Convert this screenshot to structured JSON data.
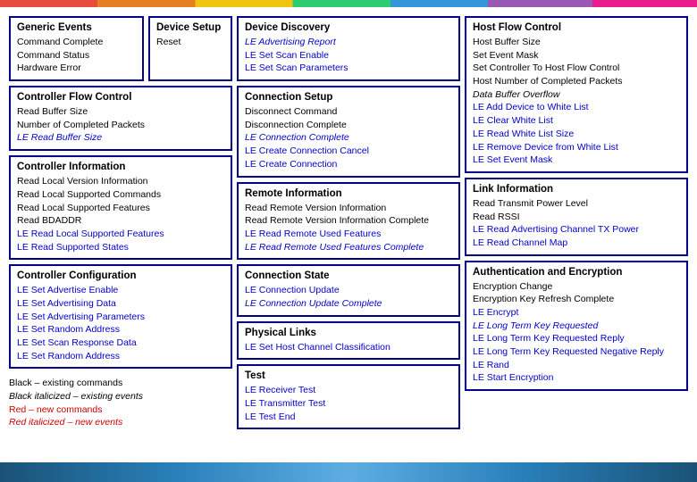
{
  "rainbow": true,
  "columns": {
    "col1": {
      "row1": {
        "boxes": [
          {
            "id": "generic-events",
            "title": "Generic Events",
            "items": [
              {
                "text": "Command Complete",
                "style": "normal"
              },
              {
                "text": "Command Status",
                "style": "normal"
              },
              {
                "text": "Hardware Error",
                "style": "normal"
              }
            ]
          },
          {
            "id": "device-setup",
            "title": "Device Setup",
            "items": [
              {
                "text": "Reset",
                "style": "normal"
              }
            ]
          }
        ]
      },
      "row2": {
        "id": "controller-flow",
        "title": "Controller Flow Control",
        "items": [
          {
            "text": "Read Buffer Size",
            "style": "normal"
          },
          {
            "text": "Number of Completed Packets",
            "style": "normal"
          },
          {
            "text": "LE Read Buffer Size",
            "style": "blue-italic"
          }
        ]
      },
      "row3": {
        "id": "controller-info",
        "title": "Controller Information",
        "items": [
          {
            "text": "Read Local Version Information",
            "style": "normal"
          },
          {
            "text": "Read Local Supported Commands",
            "style": "normal"
          },
          {
            "text": "Read Local Supported Features",
            "style": "normal"
          },
          {
            "text": "Read BDADDR",
            "style": "normal"
          },
          {
            "text": "LE Read Local Supported Features",
            "style": "blue"
          },
          {
            "text": "LE Read Supported States",
            "style": "blue"
          }
        ]
      },
      "row4": {
        "id": "controller-config",
        "title": "Controller Configuration",
        "items": [
          {
            "text": "LE Set Advertise Enable",
            "style": "blue"
          },
          {
            "text": "LE Set Advertising Data",
            "style": "blue"
          },
          {
            "text": "LE Set Advertising Parameters",
            "style": "blue"
          },
          {
            "text": "LE Set Random Address",
            "style": "blue"
          },
          {
            "text": "LE Set Scan Response Data",
            "style": "blue"
          },
          {
            "text": "LE Set Random Address",
            "style": "blue"
          }
        ]
      },
      "legend": {
        "items": [
          {
            "text": "Black – existing commands",
            "style": "black"
          },
          {
            "text": "Black italicized – existing events",
            "style": "black-italic"
          },
          {
            "text": "Red – new commands",
            "style": "red"
          },
          {
            "text": "Red italicized – new events",
            "style": "red-italic"
          }
        ]
      }
    },
    "col2": {
      "row1": {
        "id": "device-discovery",
        "title": "Device Discovery",
        "items": [
          {
            "text": "LE Advertising Report",
            "style": "blue-italic"
          },
          {
            "text": "LE Set Scan Enable",
            "style": "blue"
          },
          {
            "text": "LE Set Scan Parameters",
            "style": "blue"
          }
        ]
      },
      "row2": {
        "id": "connection-setup",
        "title": "Connection Setup",
        "items": [
          {
            "text": "Disconnect Command",
            "style": "normal"
          },
          {
            "text": "Disconnection Complete",
            "style": "normal"
          },
          {
            "text": "LE Connection Complete",
            "style": "blue-italic"
          },
          {
            "text": "LE Create Connection Cancel",
            "style": "blue"
          },
          {
            "text": "LE Create Connection",
            "style": "blue"
          }
        ]
      },
      "row3": {
        "id": "remote-info",
        "title": "Remote Information",
        "items": [
          {
            "text": "Read Remote Version Information",
            "style": "normal"
          },
          {
            "text": "Read Remote Version Information Complete",
            "style": "normal"
          },
          {
            "text": "LE Read Remote Used Features",
            "style": "blue"
          },
          {
            "text": "LE Read Remote Used Features Complete",
            "style": "blue-italic"
          }
        ]
      },
      "row4": {
        "id": "connection-state",
        "title": "Connection State",
        "items": [
          {
            "text": "LE Connection Update",
            "style": "blue"
          },
          {
            "text": "LE Connection Update Complete",
            "style": "blue-italic"
          }
        ]
      },
      "row5": {
        "id": "physical-links",
        "title": "Physical Links",
        "items": [
          {
            "text": "LE Set Host Channel Classification",
            "style": "blue"
          }
        ]
      },
      "row6": {
        "id": "test",
        "title": "Test",
        "items": [
          {
            "text": "LE Receiver Test",
            "style": "blue"
          },
          {
            "text": "LE Transmitter Test",
            "style": "blue"
          },
          {
            "text": "LE Test End",
            "style": "blue"
          }
        ]
      }
    },
    "col3": {
      "row1": {
        "id": "host-flow",
        "title": "Host Flow Control",
        "items": [
          {
            "text": "Host Buffer Size",
            "style": "normal"
          },
          {
            "text": "Set Event Mask",
            "style": "normal"
          },
          {
            "text": "Set Controller To Host Flow Control",
            "style": "normal"
          },
          {
            "text": "Host Number of Completed Packets",
            "style": "normal"
          },
          {
            "text": "Data Buffer Overflow",
            "style": "normal-italic"
          },
          {
            "text": "LE Add Device to White List",
            "style": "blue"
          },
          {
            "text": "LE Clear White List",
            "style": "blue"
          },
          {
            "text": "LE Read White List Size",
            "style": "blue"
          },
          {
            "text": "LE Remove Device from White List",
            "style": "blue"
          },
          {
            "text": "LE Set Event Mask",
            "style": "blue"
          }
        ]
      },
      "row2": {
        "id": "link-info",
        "title": "Link Information",
        "items": [
          {
            "text": "Read Transmit Power Level",
            "style": "normal"
          },
          {
            "text": "Read RSSI",
            "style": "normal"
          },
          {
            "text": "LE Read Advertising Channel TX Power",
            "style": "blue"
          },
          {
            "text": "LE Read Channel Map",
            "style": "blue"
          }
        ]
      },
      "row3": {
        "id": "auth-encryption",
        "title": "Authentication and Encryption",
        "items": [
          {
            "text": "Encryption Change",
            "style": "normal"
          },
          {
            "text": "Encryption Key Refresh Complete",
            "style": "normal"
          },
          {
            "text": "LE Encrypt",
            "style": "blue"
          },
          {
            "text": "LE Long Term Key Requested",
            "style": "blue-italic"
          },
          {
            "text": "LE Long Term Key Requested Reply",
            "style": "blue"
          },
          {
            "text": "LE Long Term Key Requested Negative Reply",
            "style": "blue"
          },
          {
            "text": "LE Rand",
            "style": "blue"
          },
          {
            "text": "LE Start Encryption",
            "style": "blue"
          }
        ]
      }
    }
  }
}
